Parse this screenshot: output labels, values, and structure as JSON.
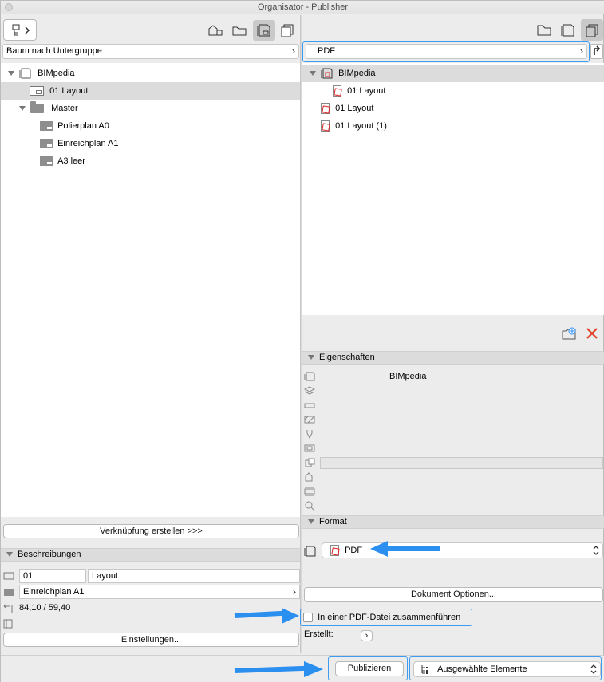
{
  "window": {
    "title": "Organisator - Publisher"
  },
  "left": {
    "tree_dropdown": "Baum nach Untergruppe",
    "tree": [
      {
        "label": "BIMpedia"
      },
      {
        "label": "01 Layout"
      },
      {
        "label": "Master"
      },
      {
        "label": "Polierplan A0"
      },
      {
        "label": "Einreichplan A1"
      },
      {
        "label": "A3 leer"
      }
    ],
    "link_button": "Verknüpfung erstellen >>>",
    "descriptions": {
      "header": "Beschreibungen",
      "id_value": "01",
      "name_value": "Layout",
      "master_value": "Einreichplan A1",
      "size_value": "84,10 / 59,40",
      "settings_button": "Einstellungen..."
    }
  },
  "right": {
    "set_dropdown": "PDF",
    "tree": [
      {
        "label": "BIMpedia"
      },
      {
        "label": "01 Layout"
      },
      {
        "label": "01 Layout"
      },
      {
        "label": "01 Layout (1)"
      }
    ],
    "properties": {
      "header": "Eigenschaften",
      "name_value": "BIMpedia"
    },
    "format": {
      "header": "Format",
      "value": "PDF",
      "doc_options_button": "Dokument Optionen...",
      "merge_checkbox_label": "In einer PDF-Datei zusammenführen",
      "merge_checked": false,
      "created_label": "Erstellt:"
    },
    "publish_button": "Publizieren",
    "publish_scope": "Ausgewählte Elemente"
  },
  "colors": {
    "accent": "#3d9cf0",
    "arrow": "#2b8ff0",
    "delete": "#e0442c",
    "selection": "#dcdcdc"
  }
}
